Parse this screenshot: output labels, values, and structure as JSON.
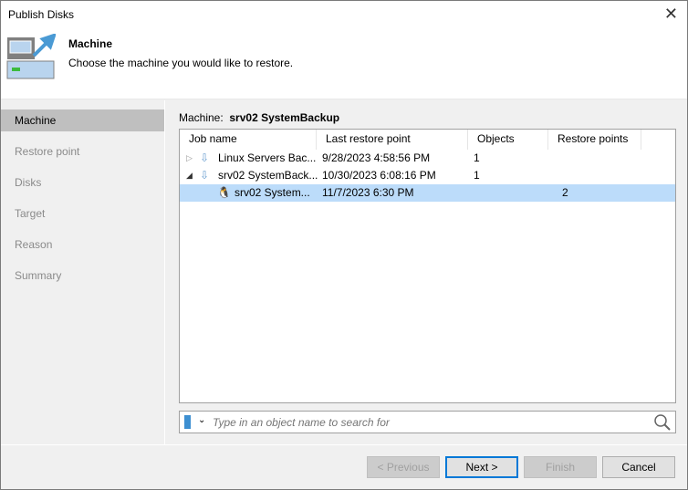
{
  "window": {
    "title": "Publish Disks"
  },
  "header": {
    "title": "Machine",
    "subtitle": "Choose the machine you would like to restore."
  },
  "sidebar": {
    "items": [
      {
        "label": "Machine"
      },
      {
        "label": "Restore point"
      },
      {
        "label": "Disks"
      },
      {
        "label": "Target"
      },
      {
        "label": "Reason"
      },
      {
        "label": "Summary"
      }
    ]
  },
  "main": {
    "machine_label": "Machine:",
    "machine_value": "srv02 SystemBackup",
    "columns": [
      "Job name",
      "Last restore point",
      "Objects",
      "Restore points"
    ],
    "rows": [
      {
        "name": "Linux Servers Bac...",
        "last": "9/28/2023 4:58:56 PM",
        "objects": "1",
        "points": ""
      },
      {
        "name": "srv02 SystemBack...",
        "last": "10/30/2023 6:08:16 PM",
        "objects": "1",
        "points": ""
      },
      {
        "name": "srv02 System...",
        "last": "11/7/2023 6:30 PM",
        "objects": "",
        "points": "2"
      }
    ],
    "search_placeholder": "Type in an object name to search for"
  },
  "buttons": {
    "previous": "< Previous",
    "next": "Next >",
    "finish": "Finish",
    "cancel": "Cancel"
  }
}
